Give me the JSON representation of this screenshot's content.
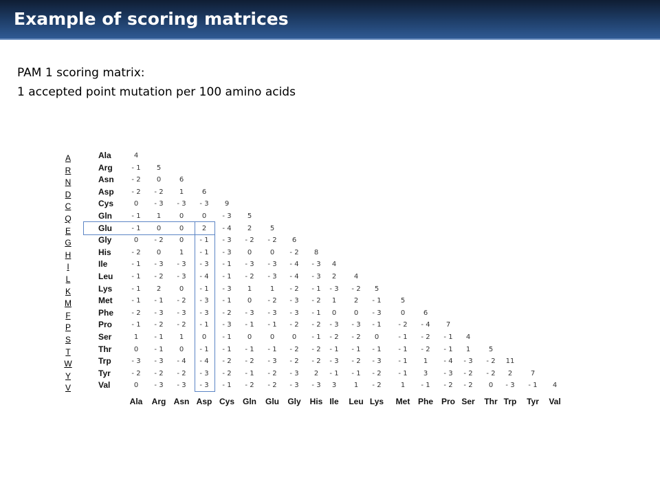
{
  "slide": {
    "title": "Example of scoring matrices",
    "subtitle_line1": "PAM 1 scoring matrix:",
    "subtitle_line2": "1 accepted point mutation per 100 amino acids"
  },
  "matrix": {
    "one_letter_codes": [
      "A",
      "R",
      "N",
      "D",
      "C",
      "Q",
      "E",
      "G",
      "H",
      "I",
      "L",
      "K",
      "M",
      "F",
      "P",
      "S",
      "T",
      "W",
      "Y",
      "V"
    ],
    "row_labels": [
      "Ala",
      "Arg",
      "Asn",
      "Asp",
      "Cys",
      "Gln",
      "Glu",
      "Gly",
      "His",
      "Ile",
      "Leu",
      "Lys",
      "Met",
      "Phe",
      "Pro",
      "Ser",
      "Thr",
      "Trp",
      "Tyr",
      "Val"
    ],
    "col_labels": [
      "Ala",
      "Arg",
      "Asn",
      "Asp",
      "Cys",
      "Gln",
      "Glu",
      "Gly",
      "His",
      "Ile",
      "Leu",
      "Lys",
      "Met",
      "Phe",
      "Pro",
      "Ser",
      "Thr",
      "Trp",
      "Tyr",
      "Val"
    ],
    "rows": [
      [
        "4"
      ],
      [
        "- 1",
        "5"
      ],
      [
        "- 2",
        "0",
        "6"
      ],
      [
        "- 2",
        "- 2",
        "1",
        "6"
      ],
      [
        "0",
        "- 3",
        "- 3",
        "- 3",
        "9"
      ],
      [
        "- 1",
        "1",
        "0",
        "0",
        "- 3",
        "5"
      ],
      [
        "- 1",
        "0",
        "0",
        "2",
        "- 4",
        "2",
        "5"
      ],
      [
        "0",
        "- 2",
        "0",
        "- 1",
        "- 3",
        "- 2",
        "- 2",
        "6"
      ],
      [
        "- 2",
        "0",
        "1",
        "- 1",
        "- 3",
        "0",
        "0",
        "- 2",
        "8"
      ],
      [
        "- 1",
        "- 3",
        "- 3",
        "- 3",
        "- 1",
        "- 3",
        "- 3",
        "- 4",
        "- 3",
        "4"
      ],
      [
        "- 1",
        "- 2",
        "- 3",
        "- 4",
        "- 1",
        "- 2",
        "- 3",
        "- 4",
        "- 3",
        "2",
        "4"
      ],
      [
        "- 1",
        "2",
        "0",
        "- 1",
        "- 3",
        "1",
        "1",
        "- 2",
        "- 1",
        "- 3",
        "- 2",
        "5"
      ],
      [
        "- 1",
        "- 1",
        "- 2",
        "- 3",
        "- 1",
        "0",
        "- 2",
        "- 3",
        "- 2",
        "1",
        "2",
        "- 1",
        "5"
      ],
      [
        "- 2",
        "- 3",
        "- 3",
        "- 3",
        "- 2",
        "- 3",
        "- 3",
        "- 3",
        "- 1",
        "0",
        "0",
        "- 3",
        "0",
        "6"
      ],
      [
        "- 1",
        "- 2",
        "- 2",
        "- 1",
        "- 3",
        "- 1",
        "- 1",
        "- 2",
        "- 2",
        "- 3",
        "- 3",
        "- 1",
        "- 2",
        "- 4",
        "7"
      ],
      [
        "1",
        "- 1",
        "1",
        "0",
        "- 1",
        "0",
        "0",
        "0",
        "- 1",
        "- 2",
        "- 2",
        "0",
        "- 1",
        "- 2",
        "- 1",
        "4"
      ],
      [
        "0",
        "- 1",
        "0",
        "- 1",
        "- 1",
        "- 1",
        "- 1",
        "- 2",
        "- 2",
        "- 1",
        "- 1",
        "- 1",
        "- 1",
        "- 2",
        "- 1",
        "1",
        "5"
      ],
      [
        "- 3",
        "- 3",
        "- 4",
        "- 4",
        "- 2",
        "- 2",
        "- 3",
        "- 2",
        "- 2",
        "- 3",
        "- 2",
        "- 3",
        "- 1",
        "1",
        "- 4",
        "- 3",
        "- 2",
        "11"
      ],
      [
        "- 2",
        "- 2",
        "- 2",
        "- 3",
        "- 2",
        "- 1",
        "- 2",
        "- 3",
        "2",
        "- 1",
        "- 1",
        "- 2",
        "- 1",
        "3",
        "- 3",
        "- 2",
        "- 2",
        "2",
        "7"
      ],
      [
        "0",
        "- 3",
        "- 3",
        "- 3",
        "- 1",
        "- 2",
        "- 2",
        "- 3",
        "- 3",
        "3",
        "1",
        "- 2",
        "1",
        "- 1",
        "- 2",
        "- 2",
        "0",
        "- 3",
        "- 1",
        "4"
      ]
    ],
    "highlight_row": "Glu",
    "highlight_col": "Asp",
    "highlight_color": "#5b84c4"
  }
}
